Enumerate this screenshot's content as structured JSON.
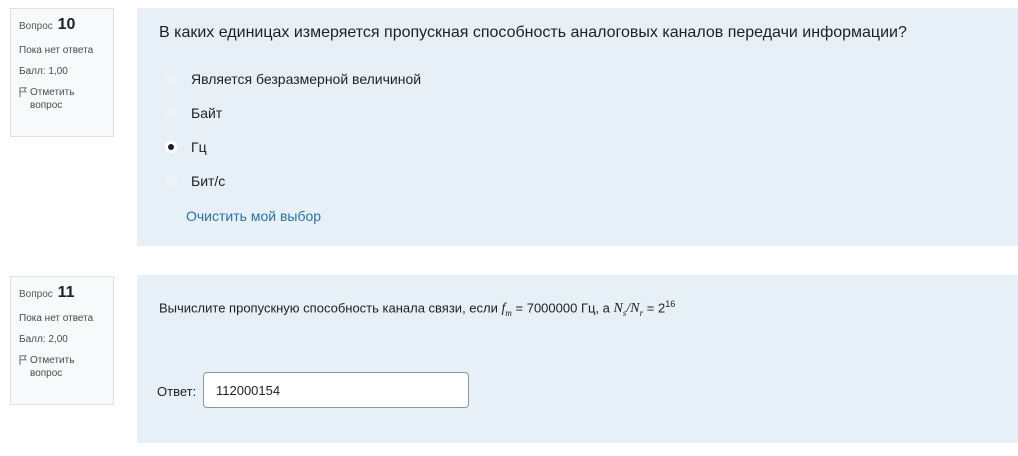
{
  "q1": {
    "label": "Вопрос",
    "number": "10",
    "status": "Пока нет ответа",
    "score": "Балл: 1,00",
    "flag": "Отметить вопрос",
    "text": "В каких единицах измеряется пропускная способность аналоговых каналов передачи информации?",
    "options": [
      {
        "label": "Является безразмерной величиной",
        "checked": false
      },
      {
        "label": "Байт",
        "checked": false
      },
      {
        "label": "Гц",
        "checked": true
      },
      {
        "label": "Бит/с",
        "checked": false
      }
    ],
    "clear_label": "Очистить мой выбор"
  },
  "q2": {
    "label": "Вопрос",
    "number": "11",
    "status": "Пока нет ответа",
    "score": "Балл: 2,00",
    "flag": "Отметить вопрос",
    "text_prefix": "Вычислите пропускную способность канала связи, если",
    "f_sym": "f",
    "f_sub": "m",
    "eq1": "= 7000000 Гц, а",
    "n1": "N",
    "n1_sub": "s",
    "slash": "/",
    "n2": "N",
    "n2_sub": "r",
    "eq2": "= 2",
    "exponent": "16",
    "answer_label": "Ответ:",
    "answer_value": "112000154"
  },
  "colors": {
    "content_bg": "#e7f0f6",
    "info_bg": "#f8f9fa",
    "link": "#2673ad"
  }
}
